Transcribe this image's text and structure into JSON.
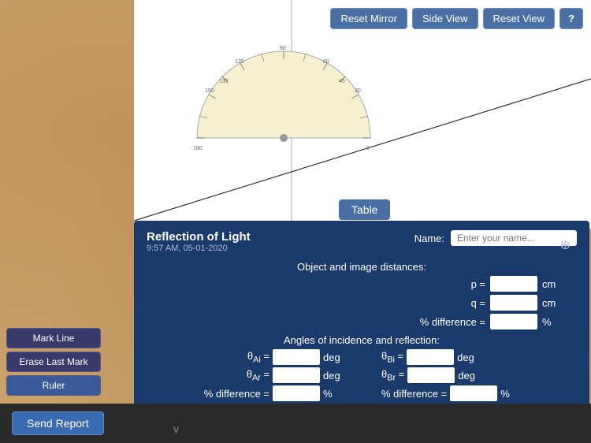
{
  "app": {
    "title": "Reflection of Light",
    "date": "9:57 AM, 05-01-2020"
  },
  "toolbar": {
    "reset_mirror": "Reset Mirror",
    "side_view": "Side View",
    "reset_view": "Reset View",
    "help": "?"
  },
  "table_button": "Table",
  "name_label": "Name:",
  "name_placeholder": "Enter your name...",
  "sections": {
    "distances": "Object and image distances:",
    "angles": "Angles of incidence and reflection:"
  },
  "fields": {
    "p_label": "p =",
    "p_unit": "cm",
    "q_label": "q =",
    "q_unit": "cm",
    "diff_label": "% difference =",
    "diff_unit": "%",
    "theta_ai": "θ",
    "theta_ai_sub": "Ai",
    "theta_ai_unit": "deg",
    "theta_ar": "θ",
    "theta_ar_sub": "Ar",
    "theta_ar_unit": "deg",
    "diff_a_label": "% difference =",
    "diff_a_unit": "%",
    "theta_bi": "θ",
    "theta_bi_sub": "Bi",
    "theta_bi_unit": "deg",
    "theta_br": "θ",
    "theta_br_sub": "Br",
    "theta_br_unit": "deg",
    "diff_b_label": "% difference =",
    "diff_b_unit": "%"
  },
  "left_panel": {
    "mark_line": "Mark Line",
    "erase_last": "Erase Last Mark",
    "ruler": "Ruler"
  },
  "bottom": {
    "send_report": "Send Report",
    "chevron": "v"
  },
  "colors": {
    "panel_bg": "#1a3a6b",
    "toolbar_bg": "#4a6fa5",
    "bottom_bg": "#2a2a2a"
  }
}
